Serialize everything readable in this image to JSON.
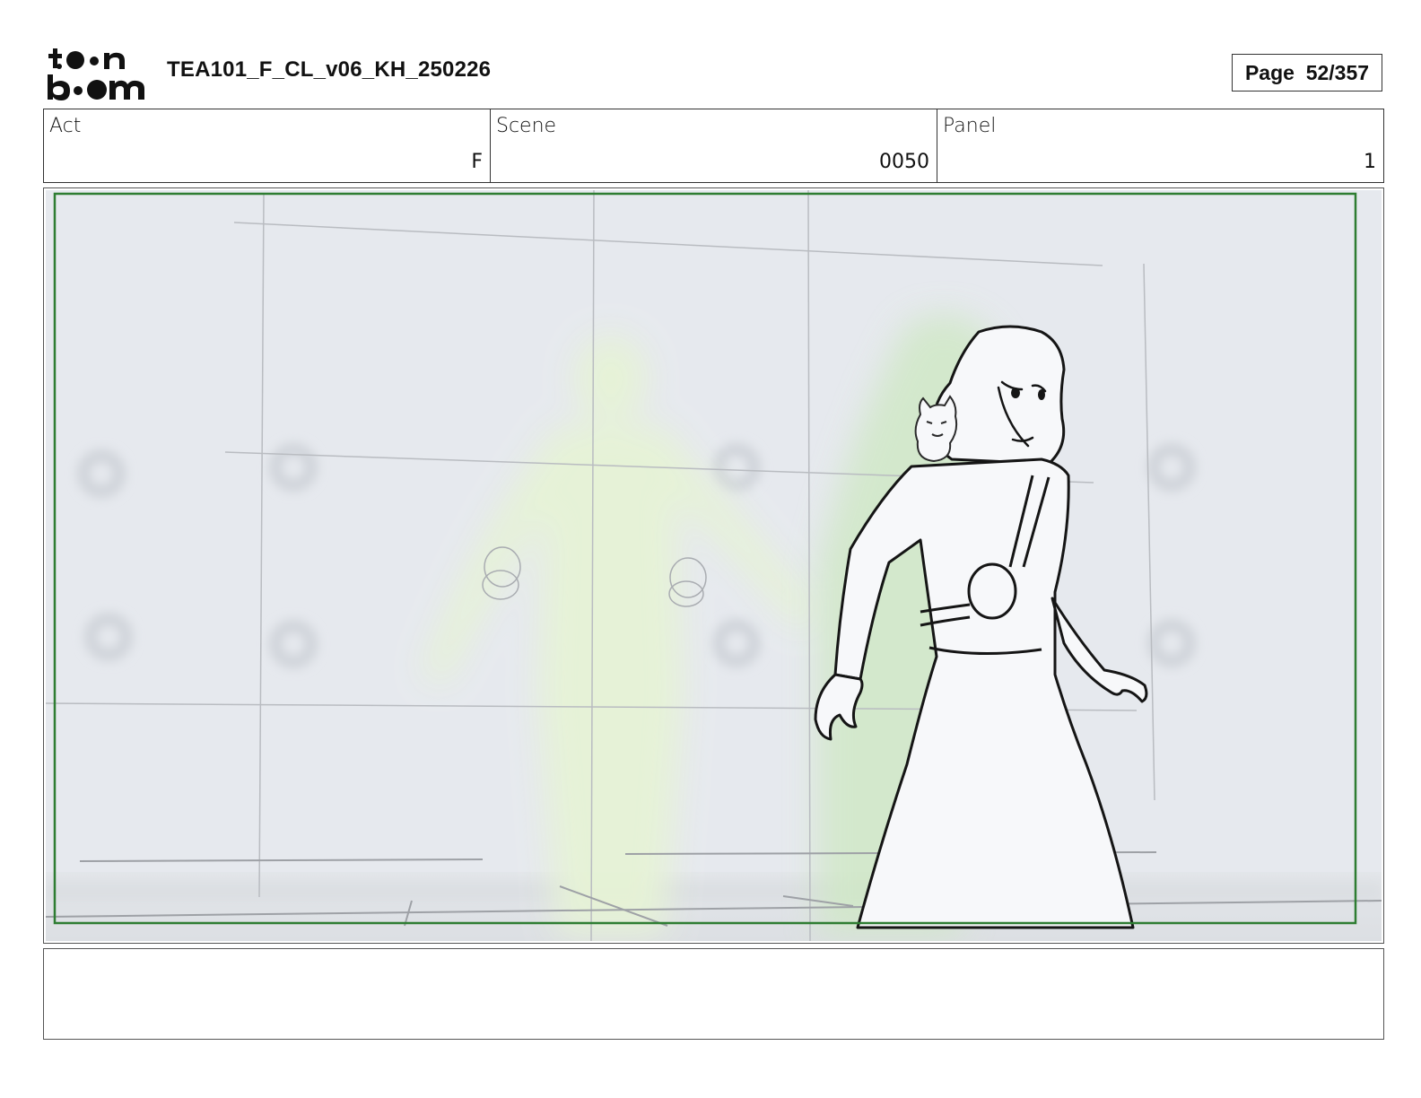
{
  "header": {
    "logo_text": "toon boom",
    "logo_icon": "toon-boom-logo",
    "document_title": "TEA101_F_CL_v06_KH_250226",
    "page_label": "Page  52/357"
  },
  "info": {
    "act": {
      "label": "Act",
      "value": "F"
    },
    "scene": {
      "label": "Scene",
      "value": "0050"
    },
    "panel": {
      "label": "Panel",
      "value": "1"
    }
  },
  "panel_image": {
    "description_icon": "storyboard-sketch-image",
    "safe_frame_color": "#2e7d32",
    "background_color": "#e6e9ee",
    "glow_color": "#e9f5d9"
  },
  "notes": {
    "text": ""
  }
}
